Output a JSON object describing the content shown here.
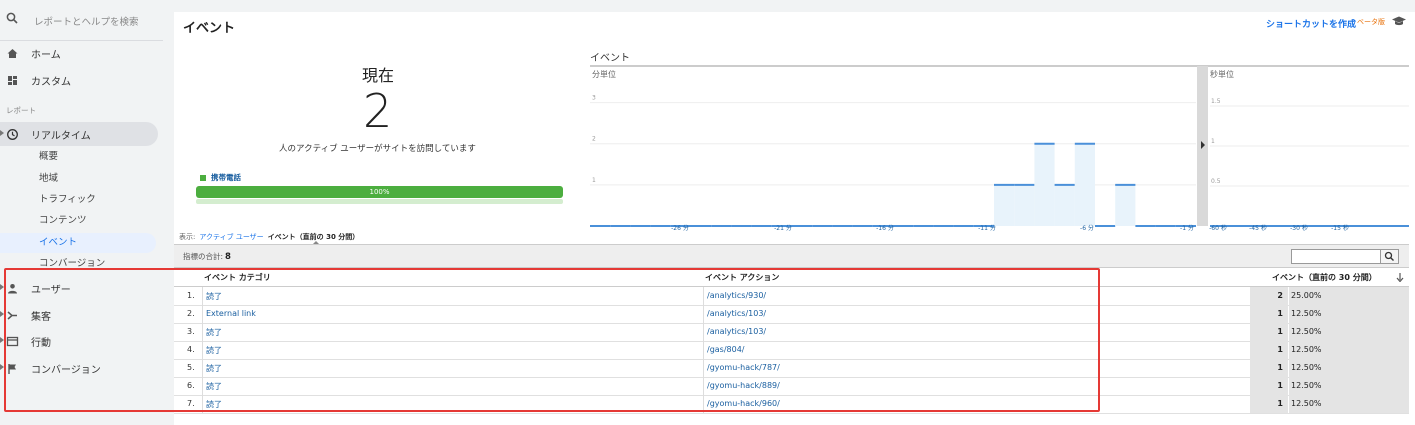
{
  "sidebar": {
    "search_placeholder": "レポートとヘルプを検索",
    "home": "ホーム",
    "custom": "カスタム",
    "section_reports": "レポート",
    "realtime": "リアルタイム",
    "realtime_items": [
      "概要",
      "地域",
      "トラフィック",
      "コンテンツ",
      "イベント",
      "コンバージョン"
    ],
    "user": "ユーザー",
    "acquisition": "集客",
    "behavior": "行動",
    "conversion": "コンバージョン"
  },
  "header": {
    "title": "イベント",
    "shortcut": "ショートカットを作成",
    "beta": "ベータ版"
  },
  "summary": {
    "now_label": "現在",
    "active_count": "2",
    "description": "人のアクティブ ユーザーがサイトを訪問しています",
    "device_legend": "携帯電話",
    "device_percent_label": "100%",
    "device_fraction": 1.0
  },
  "colors": {
    "accent": "#1a73e8",
    "device_green": "#4cae3f",
    "bar_blue": "#4a90d9",
    "highlight_red": "#e53935"
  },
  "chart_data": [
    {
      "type": "area",
      "title": "イベント",
      "subtitle": "分単位",
      "x": [
        "-26 分",
        "-21 分",
        "-16 分",
        "-11 分",
        "-6 分",
        "-1 分"
      ],
      "y_ticks": [
        "1",
        "2",
        "3"
      ],
      "per_minute": [
        0,
        0,
        0,
        0,
        0,
        0,
        0,
        0,
        0,
        0,
        0,
        0,
        0,
        0,
        0,
        0,
        0,
        0,
        0,
        0,
        1,
        1,
        2,
        1,
        2,
        0,
        1,
        0,
        0,
        0
      ],
      "ylim": [
        0,
        3.5
      ]
    },
    {
      "type": "area",
      "subtitle": "秒単位",
      "x": [
        "-60 秒",
        "-45 秒",
        "-30 秒",
        "-15 秒"
      ],
      "y_ticks": [
        "0.5",
        "1",
        "1.5"
      ],
      "ylim": [
        0,
        1.8
      ]
    }
  ],
  "toggle": {
    "label": "表示:",
    "active_users": "アクティブ ユーザー",
    "events_30": "イベント（直前の 30 分間）"
  },
  "table": {
    "total_label": "指標の合計:",
    "total_value": "8",
    "headers": {
      "category": "イベント カテゴリ",
      "action": "イベント アクション",
      "events": "イベント（直前の 30 分間）"
    },
    "rows": [
      {
        "n": "1.",
        "category": "読了",
        "action": "/analytics/930/",
        "count": "2",
        "pct": "25.00%"
      },
      {
        "n": "2.",
        "category": "External link",
        "action": "/analytics/103/",
        "count": "1",
        "pct": "12.50%"
      },
      {
        "n": "3.",
        "category": "読了",
        "action": "/analytics/103/",
        "count": "1",
        "pct": "12.50%"
      },
      {
        "n": "4.",
        "category": "読了",
        "action": "/gas/804/",
        "count": "1",
        "pct": "12.50%"
      },
      {
        "n": "5.",
        "category": "読了",
        "action": "/gyomu-hack/787/",
        "count": "1",
        "pct": "12.50%"
      },
      {
        "n": "6.",
        "category": "読了",
        "action": "/gyomu-hack/889/",
        "count": "1",
        "pct": "12.50%"
      },
      {
        "n": "7.",
        "category": "読了",
        "action": "/gyomu-hack/960/",
        "count": "1",
        "pct": "12.50%"
      }
    ]
  }
}
